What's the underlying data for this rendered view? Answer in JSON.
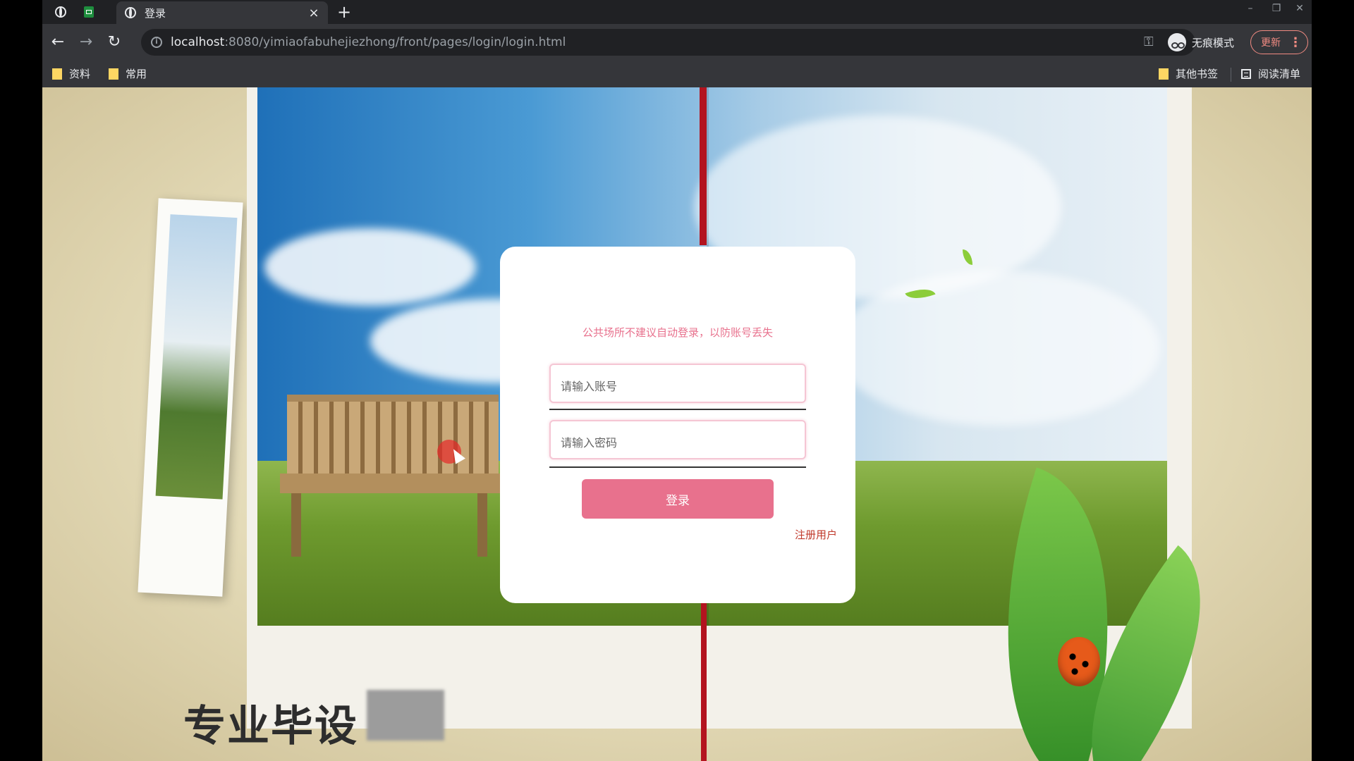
{
  "browser": {
    "tab_title": "登录",
    "tab_close": "×",
    "new_tab": "+",
    "url_host": "localhost",
    "url_rest": ":8080/yimiaofabuhejiezhong/front/pages/login/login.html",
    "incognito_label": "无痕模式",
    "update_label": "更新",
    "window_controls": [
      "–",
      "❐",
      "✕"
    ]
  },
  "bookmarks": {
    "left": [
      "资料",
      "常用"
    ],
    "right": [
      "其他书签",
      "阅读清单"
    ]
  },
  "login": {
    "notice": "公共场所不建议自动登录，以防账号丢失",
    "username_placeholder": "请输入账号",
    "password_placeholder": "请输入密码",
    "submit_label": "登录",
    "register_link": "注册用户"
  },
  "overlay": {
    "watermark_text": "专业毕设"
  },
  "colors": {
    "accent": "#e8718d",
    "input_border": "#f5c6d4",
    "register_link": "#c0392b"
  }
}
